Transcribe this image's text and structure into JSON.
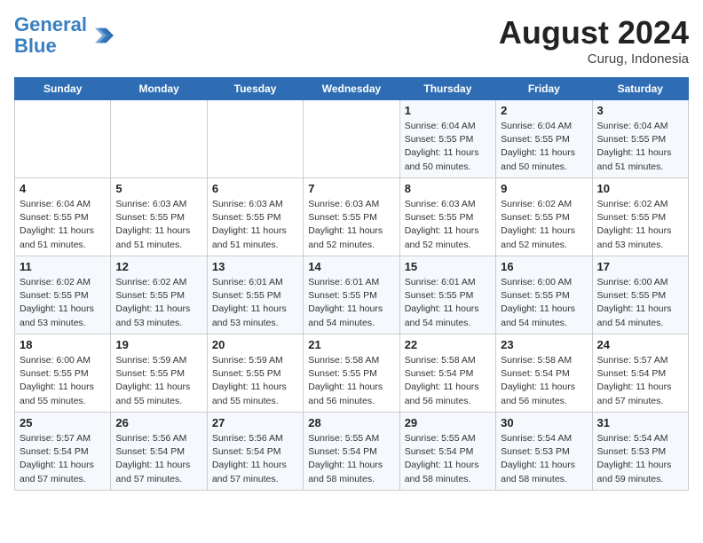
{
  "header": {
    "logo_line1": "General",
    "logo_line2": "Blue",
    "month_year": "August 2024",
    "location": "Curug, Indonesia"
  },
  "weekdays": [
    "Sunday",
    "Monday",
    "Tuesday",
    "Wednesday",
    "Thursday",
    "Friday",
    "Saturday"
  ],
  "weeks": [
    [
      {
        "day": "",
        "info": ""
      },
      {
        "day": "",
        "info": ""
      },
      {
        "day": "",
        "info": ""
      },
      {
        "day": "",
        "info": ""
      },
      {
        "day": "1",
        "info": "Sunrise: 6:04 AM\nSunset: 5:55 PM\nDaylight: 11 hours\nand 50 minutes."
      },
      {
        "day": "2",
        "info": "Sunrise: 6:04 AM\nSunset: 5:55 PM\nDaylight: 11 hours\nand 50 minutes."
      },
      {
        "day": "3",
        "info": "Sunrise: 6:04 AM\nSunset: 5:55 PM\nDaylight: 11 hours\nand 51 minutes."
      }
    ],
    [
      {
        "day": "4",
        "info": "Sunrise: 6:04 AM\nSunset: 5:55 PM\nDaylight: 11 hours\nand 51 minutes."
      },
      {
        "day": "5",
        "info": "Sunrise: 6:03 AM\nSunset: 5:55 PM\nDaylight: 11 hours\nand 51 minutes."
      },
      {
        "day": "6",
        "info": "Sunrise: 6:03 AM\nSunset: 5:55 PM\nDaylight: 11 hours\nand 51 minutes."
      },
      {
        "day": "7",
        "info": "Sunrise: 6:03 AM\nSunset: 5:55 PM\nDaylight: 11 hours\nand 52 minutes."
      },
      {
        "day": "8",
        "info": "Sunrise: 6:03 AM\nSunset: 5:55 PM\nDaylight: 11 hours\nand 52 minutes."
      },
      {
        "day": "9",
        "info": "Sunrise: 6:02 AM\nSunset: 5:55 PM\nDaylight: 11 hours\nand 52 minutes."
      },
      {
        "day": "10",
        "info": "Sunrise: 6:02 AM\nSunset: 5:55 PM\nDaylight: 11 hours\nand 53 minutes."
      }
    ],
    [
      {
        "day": "11",
        "info": "Sunrise: 6:02 AM\nSunset: 5:55 PM\nDaylight: 11 hours\nand 53 minutes."
      },
      {
        "day": "12",
        "info": "Sunrise: 6:02 AM\nSunset: 5:55 PM\nDaylight: 11 hours\nand 53 minutes."
      },
      {
        "day": "13",
        "info": "Sunrise: 6:01 AM\nSunset: 5:55 PM\nDaylight: 11 hours\nand 53 minutes."
      },
      {
        "day": "14",
        "info": "Sunrise: 6:01 AM\nSunset: 5:55 PM\nDaylight: 11 hours\nand 54 minutes."
      },
      {
        "day": "15",
        "info": "Sunrise: 6:01 AM\nSunset: 5:55 PM\nDaylight: 11 hours\nand 54 minutes."
      },
      {
        "day": "16",
        "info": "Sunrise: 6:00 AM\nSunset: 5:55 PM\nDaylight: 11 hours\nand 54 minutes."
      },
      {
        "day": "17",
        "info": "Sunrise: 6:00 AM\nSunset: 5:55 PM\nDaylight: 11 hours\nand 54 minutes."
      }
    ],
    [
      {
        "day": "18",
        "info": "Sunrise: 6:00 AM\nSunset: 5:55 PM\nDaylight: 11 hours\nand 55 minutes."
      },
      {
        "day": "19",
        "info": "Sunrise: 5:59 AM\nSunset: 5:55 PM\nDaylight: 11 hours\nand 55 minutes."
      },
      {
        "day": "20",
        "info": "Sunrise: 5:59 AM\nSunset: 5:55 PM\nDaylight: 11 hours\nand 55 minutes."
      },
      {
        "day": "21",
        "info": "Sunrise: 5:58 AM\nSunset: 5:55 PM\nDaylight: 11 hours\nand 56 minutes."
      },
      {
        "day": "22",
        "info": "Sunrise: 5:58 AM\nSunset: 5:54 PM\nDaylight: 11 hours\nand 56 minutes."
      },
      {
        "day": "23",
        "info": "Sunrise: 5:58 AM\nSunset: 5:54 PM\nDaylight: 11 hours\nand 56 minutes."
      },
      {
        "day": "24",
        "info": "Sunrise: 5:57 AM\nSunset: 5:54 PM\nDaylight: 11 hours\nand 57 minutes."
      }
    ],
    [
      {
        "day": "25",
        "info": "Sunrise: 5:57 AM\nSunset: 5:54 PM\nDaylight: 11 hours\nand 57 minutes."
      },
      {
        "day": "26",
        "info": "Sunrise: 5:56 AM\nSunset: 5:54 PM\nDaylight: 11 hours\nand 57 minutes."
      },
      {
        "day": "27",
        "info": "Sunrise: 5:56 AM\nSunset: 5:54 PM\nDaylight: 11 hours\nand 57 minutes."
      },
      {
        "day": "28",
        "info": "Sunrise: 5:55 AM\nSunset: 5:54 PM\nDaylight: 11 hours\nand 58 minutes."
      },
      {
        "day": "29",
        "info": "Sunrise: 5:55 AM\nSunset: 5:54 PM\nDaylight: 11 hours\nand 58 minutes."
      },
      {
        "day": "30",
        "info": "Sunrise: 5:54 AM\nSunset: 5:53 PM\nDaylight: 11 hours\nand 58 minutes."
      },
      {
        "day": "31",
        "info": "Sunrise: 5:54 AM\nSunset: 5:53 PM\nDaylight: 11 hours\nand 59 minutes."
      }
    ]
  ]
}
